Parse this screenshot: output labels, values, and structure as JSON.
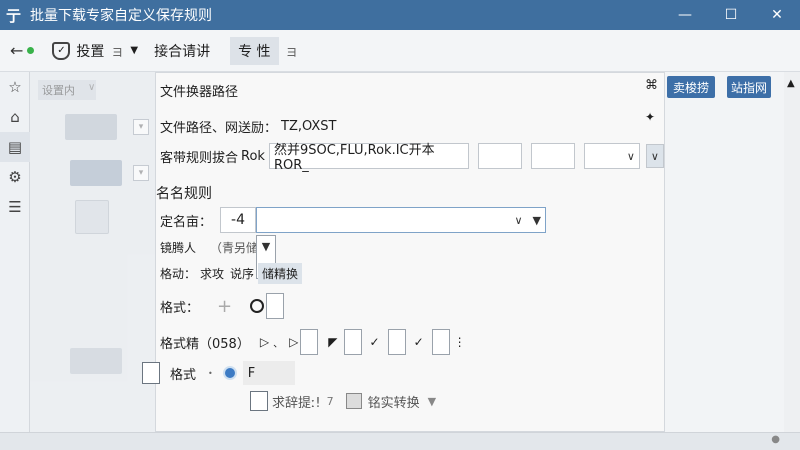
{
  "window": {
    "title": "批量下载专家自定义保存规则",
    "app_icon": "亍",
    "minimize": "—",
    "maximize": "☐",
    "close": "✕"
  },
  "toolbar": {
    "back": "←",
    "settings_label": "投置",
    "settings_suffix": "ョ",
    "menu_label": "接合请讲",
    "tab_label": "专 性",
    "tab_suffix": "ョ"
  },
  "background_panel": {
    "crumb": "设置内",
    "crumb_caret": "∨"
  },
  "dialog": {
    "path_title": "文件换器路径",
    "path_label": "文件路径、网送励：",
    "path_value": "TZ,OXST",
    "rule_label": "客带规则拔合",
    "rule_prefix": "Rok",
    "rule_value": "然并9SOC,FLU,Rok.IC开本ROR_",
    "naming_title": "名名规则",
    "name_label": "定名亩：",
    "name_value": "-4",
    "user_label": "镜腾人",
    "user_value": "（青另储",
    "move_label": "格动：",
    "move_opt1": "求攻",
    "move_opt2": "说序",
    "move_opt3": "储精换",
    "format_label": "格式：",
    "format_plus": "+",
    "format2_label": "格式精（058）",
    "format3_label": "格式",
    "format3_value": "F",
    "checkbox_label": "求辞提ː!",
    "checkbox_num": "7",
    "convert_label": "铭实转换"
  },
  "right": {
    "pin": "⌘",
    "pin2": "✦",
    "btn_a": "卖梭捞",
    "btn_b": "站指网"
  },
  "colors": {
    "titlebar": "#3f6f9f",
    "accent": "#3d6fa8"
  }
}
